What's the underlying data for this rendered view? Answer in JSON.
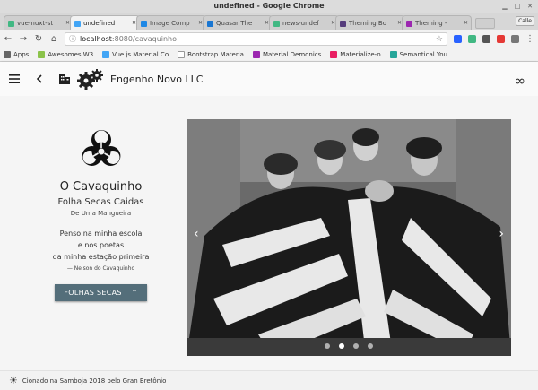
{
  "window": {
    "title": "undefined - Google Chrome"
  },
  "tabs": [
    {
      "label": "vue-nuxt-st",
      "color": "#41b883"
    },
    {
      "label": "undefined",
      "color": "#42a5f5",
      "active": true
    },
    {
      "label": "Image Comp",
      "color": "#1e88e5"
    },
    {
      "label": "Quasar The",
      "color": "#1976d2"
    },
    {
      "label": "news-undef",
      "color": "#41b883"
    },
    {
      "label": "Theming Bo",
      "color": "#563d7c"
    },
    {
      "label": "Theming - ",
      "color": "#9c27b0"
    }
  ],
  "profile": {
    "label": "Calle"
  },
  "toolbar": {
    "url_host": "localhost",
    "url_path": ":8080/cavaquinho"
  },
  "bookmarks": [
    {
      "label": "Apps",
      "color": "#666"
    },
    {
      "label": "Awesomes W3",
      "color": "#8bc34a"
    },
    {
      "label": "Vue.js Material Co",
      "color": "#42a5f5"
    },
    {
      "label": "Bootstrap Materia",
      "color": "#999"
    },
    {
      "label": "Material Demonics",
      "color": "#9c27b0"
    },
    {
      "label": "Materialize-o",
      "color": "#e91e63"
    },
    {
      "label": "Semantical You",
      "color": "#26a69a"
    }
  ],
  "appbar": {
    "brand": "Engenho Novo LLC"
  },
  "content": {
    "title": "O Cavaquinho",
    "subtitle": "Folha Secas Caidas",
    "subtitle2": "De Uma Mangueira",
    "poem": [
      "Penso na minha escola",
      "e nos poetas",
      "da minha estação primeira"
    ],
    "credit": "— Nelson do Cavaquinho",
    "button": "FOLHAS SECAS"
  },
  "carousel": {
    "slides": 4,
    "active": 1
  },
  "footer": {
    "text": "Cionado na Samboja 2018 pelo Gran Bretônio"
  }
}
